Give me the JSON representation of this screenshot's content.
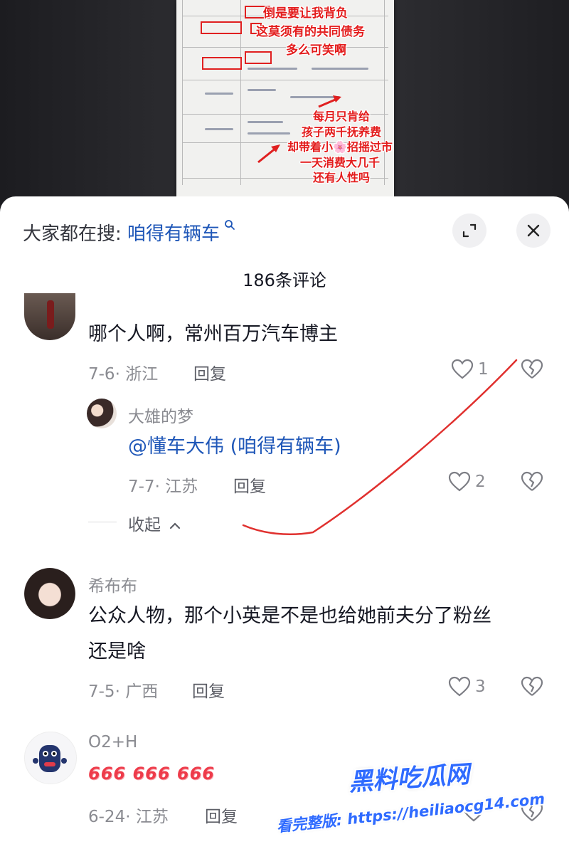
{
  "video": {
    "overlay_lines_top": [
      "倒是要让我背负",
      "这莫须有的共同债务",
      "多么可笑啊"
    ],
    "overlay_lines_bottom": [
      "每月只肯给",
      "孩子两千抚养费",
      "却带着小🌸招摇过市",
      "一天消费大几千",
      "还有人性吗"
    ]
  },
  "header": {
    "search_prefix": "大家都在搜: ",
    "search_term": "咱得有辆车",
    "expand_icon": "expand-icon",
    "close_icon": "close-icon"
  },
  "comment_count": "186条评论",
  "comments": [
    {
      "username": "",
      "text": "哪个人啊，常州百万汽车博主",
      "date_location": "7-6· 浙江",
      "reply_label": "回复",
      "likes": "1",
      "replies": [
        {
          "username": "大雄的梦",
          "text": "@懂车大伟 (咱得有辆车)",
          "date_location": "7-7· 江苏",
          "reply_label": "回复",
          "likes": "2"
        }
      ],
      "collapse_label": "收起"
    },
    {
      "username": "希布布",
      "text_line1": "公众人物，那个小英是不是也给她前夫分了粉丝",
      "text_line2": "还是啥",
      "date_location": "7-5· 广西",
      "reply_label": "回复",
      "likes": "3"
    },
    {
      "username": "O2+H",
      "text": "666 666 666",
      "date_location": "6-24· 江苏",
      "reply_label": "回复",
      "likes": ""
    }
  ],
  "watermark": {
    "brand": "黑料吃瓜网",
    "url_line": "看完整版: https://heiliaocg14.com"
  },
  "colors": {
    "link": "#1f57b8",
    "overlay_red": "#e31c1c",
    "watermark_blue": "#2f6bff",
    "annotation_red": "#e0302e"
  }
}
